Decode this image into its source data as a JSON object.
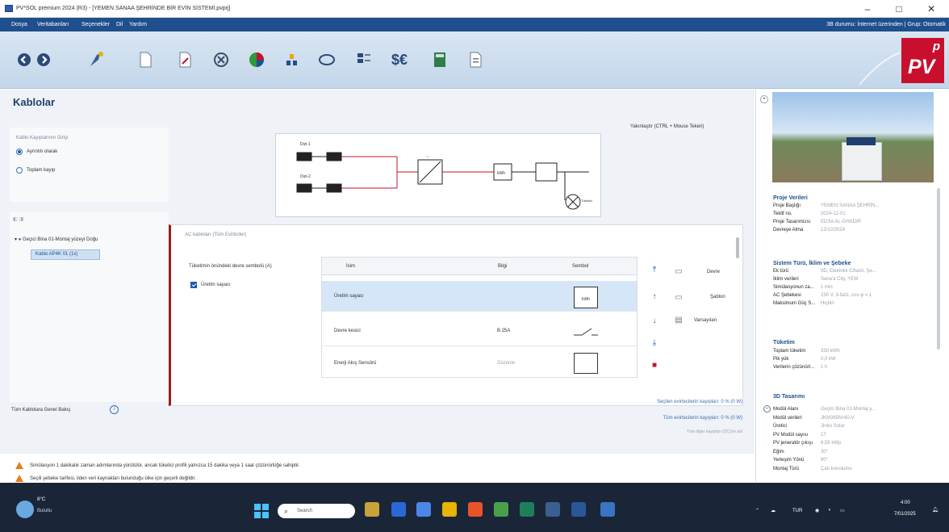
{
  "titlebar": {
    "title": "PV*SOL premium 2024 (R3) - [YEMEN SANAA ŞEHRİNDE BİR EVİN SİSTEMİ.pvprj]",
    "minimize": "–",
    "maximize": "□",
    "close": "✕"
  },
  "menu": {
    "items": [
      "Dosya",
      "Veritabanları",
      "Seçenekler",
      "Dil",
      "Yardım"
    ],
    "right_text": "3B durumu: İnternet üzerinden | Grup: Otomatik"
  },
  "toolbar": {
    "icons": [
      "back-icon",
      "forward-icon",
      "project-icon",
      "page-icon",
      "edit-icon",
      "compass-icon",
      "3d-design-icon",
      "modules-icon",
      "ring-icon",
      "table-icon",
      "financial-icon",
      "calculator-icon",
      "report-icon"
    ],
    "financial_label": "$€"
  },
  "logo": {
    "superscript": "p",
    "text": "PV"
  },
  "page": {
    "title": "Kablolar",
    "losses": {
      "title": "Kablo Kayıplarının Girişi",
      "option1": "Ayrıntılı olarak",
      "option2": "Toplam kayıp"
    },
    "zoom_hint": "Yakınlaştır (CTRL + Mouse Tekeri)",
    "tree": {
      "root": "Geçici Bina 01-Montaj yüzeyi Doğu",
      "child": "Kablo AP4K 01 (1x)"
    },
    "ac_panel": {
      "title": "AC kabloları (Tüm Evirticiler)",
      "meter_label": "Tüketimin önündeki devre sembolü (A)",
      "checkbox_label": "Üretim sayacı",
      "columns": [
        "İsim",
        "Bilgi",
        "Sembol"
      ],
      "rows": [
        {
          "name": "Üretim sayacı",
          "info": "",
          "symbol_text": "kWh"
        },
        {
          "name": "Devre kesici",
          "info": "B 25A"
        },
        {
          "name": "Enerji Akış Sensörü",
          "info": "Düzenle"
        }
      ],
      "actions": {
        "device": "Devre",
        "template": "Şablon",
        "default": "Varsayılan"
      }
    },
    "overview": "Tüm Kablolara Genel Bakış",
    "stats": [
      "Seçilen evirtecilerin kayıpları: 0 % (0 W)",
      "Tüm evirtecilerin kayıpları: 0 % (0 W)",
      "Tüm diğer kayıpları (DC)'ye atıl"
    ],
    "alerts": [
      "Simülasyon 1 dakikalık zaman adımlarında yürütülür, ancak tüketici profili yalnızca 15 dakika veya 1 saat çözünürlüğe sahiptir.",
      "Seçili şebeke tarifesi, ilden veri kaynakları bulunduğu ülke için geçerli değildir."
    ]
  },
  "diagram": {
    "labels": [
      "Dizi-1",
      "Dizi-2"
    ],
    "inv_label": "~",
    "meter_text": "kWh",
    "load_label": "Tüketici"
  },
  "sidebar": {
    "sections": [
      {
        "title": "Proje Verileri",
        "rows": [
          [
            "Proje Başlığı",
            "YEMEN SANAA ŞEHRİN..."
          ],
          [
            "Teklif no.",
            "2024-12-01"
          ],
          [
            "Proje Tasarımcısı",
            "EDSA AL-GHADIR"
          ],
          [
            "Devreye Alma",
            "12/12/2024"
          ]
        ]
      },
      {
        "title": "Sistem Türü, İklim ve Şebeke",
        "rows": [
          [
            "Ek türü",
            "3D, Elektrikli Cihazlı, Şe..."
          ],
          [
            "İklim verileri",
            "Sana'a City, YEM"
          ],
          [
            "Simülasyonun za...",
            "1 min"
          ],
          [
            "AC Şebekesi",
            "230 V, 3-fazlı, cos φ = 1"
          ],
          [
            "Maksimum Güç S...",
            "Hiçbiri"
          ]
        ]
      },
      {
        "title": "Tüketim",
        "rows": [
          [
            "Toplam tüketim",
            "330 kWh"
          ],
          [
            "Pik yük",
            "0,0 kW"
          ],
          [
            "Verilerin çözünürl...",
            "1 h"
          ]
        ]
      },
      {
        "title": "3D Tasarımı",
        "rows": [
          [
            "Modül Alanı",
            "Geçici Bina 01-Montaj y..."
          ],
          [
            "Modül verileri",
            "JKM385M-60-V"
          ],
          [
            "Üretici",
            "Jinko Solar"
          ],
          [
            "PV Modül sayısı",
            "17"
          ],
          [
            "PV jeneratör çıkışı",
            "6,55 kWp"
          ],
          [
            "Eğim",
            "30°"
          ],
          [
            "Yerleşim Yönü",
            "90°"
          ],
          [
            "Montaj Türü",
            "Çatı konulumu"
          ]
        ]
      }
    ]
  },
  "taskbar": {
    "weather_temp": "8°C",
    "weather_desc": "Bulutlu",
    "search_placeholder": "Search",
    "lang": "TUR",
    "time": "4:00",
    "date": "7/01/2025"
  },
  "colors": {
    "menubar": "#1f4f8c",
    "accent": "#c8102e",
    "panel_border": "#9b1c1c",
    "warning": "#e87c1e"
  }
}
